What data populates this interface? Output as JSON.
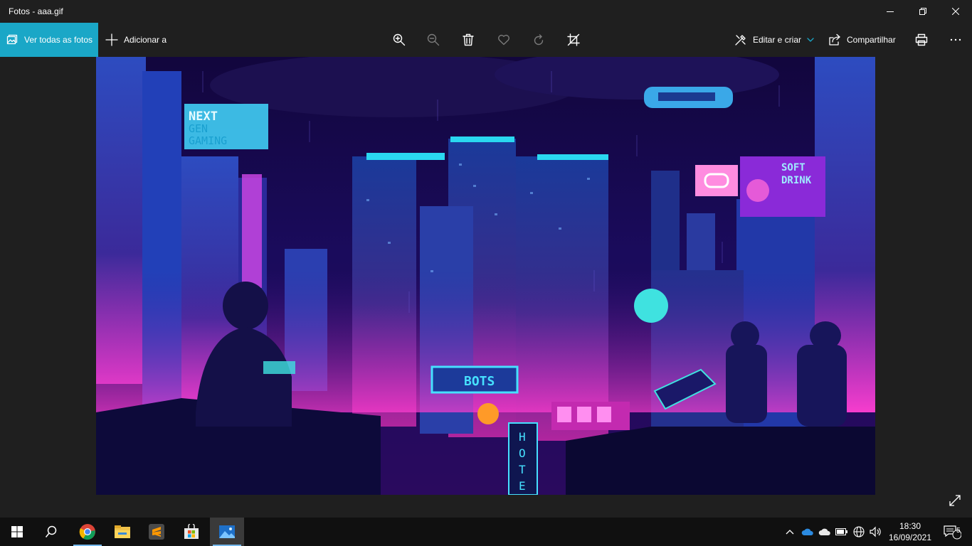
{
  "window": {
    "title": "Fotos - aaa.gif"
  },
  "toolbar": {
    "see_all_label": "Ver todas as fotos",
    "add_to_label": "Adicionar a",
    "edit_create_label": "Editar e criar",
    "share_label": "Compartilhar"
  },
  "photo": {
    "sign_next_gen": [
      "NEXT",
      "GEN",
      "GAMING"
    ],
    "sign_bots": "BOTS",
    "sign_soft_drink": [
      "SOFT",
      "DRINK"
    ],
    "sign_hotel": [
      "H",
      "O",
      "T",
      "E"
    ]
  },
  "taskbar": {
    "time": "18:30",
    "date": "16/09/2021",
    "notification_count": "5"
  },
  "colors": {
    "accent": "#1aa7c7",
    "titlebar_bg": "#1f1f1f",
    "taskbar_bg": "#101010"
  }
}
